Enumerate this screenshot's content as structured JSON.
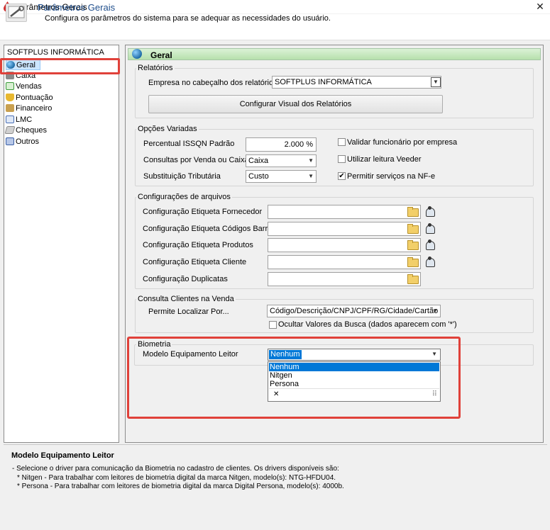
{
  "window": {
    "title": "Parâmetros Gerais",
    "close_glyph": "✕"
  },
  "header": {
    "title": "Parâmetros Gerais",
    "subtitle": "Configura os parâmetros do sistema para se adequar as necessidades do usuário."
  },
  "tree": {
    "root": "SOFTPLUS INFORMÁTICA",
    "items": [
      {
        "label": "Geral",
        "icon": "globe-icon",
        "color": "#2a7fc2"
      },
      {
        "label": "Caixa",
        "icon": "cash-register-icon",
        "color": "#7a7a7a"
      },
      {
        "label": "Vendas",
        "icon": "sales-icon",
        "color": "#3a9a3a"
      },
      {
        "label": "Pontuação",
        "icon": "trophy-icon",
        "color": "#d9a21a"
      },
      {
        "label": "Financeiro",
        "icon": "money-icon",
        "color": "#c48a2a"
      },
      {
        "label": "LMC",
        "icon": "document-icon",
        "color": "#4a6fb5"
      },
      {
        "label": "Cheques",
        "icon": "cheque-icon",
        "color": "#8a8a8a"
      },
      {
        "label": "Outros",
        "icon": "tools-icon",
        "color": "#3a5fa5"
      }
    ]
  },
  "panel": {
    "title": "Geral",
    "relatorios": {
      "legend": "Relatórios",
      "empresa_label": "Empresa no cabeçalho dos relatórios",
      "empresa_value": "SOFTPLUS INFORMÁTICA",
      "config_button": "Configurar Visual dos Relatórios"
    },
    "opcoes": {
      "legend": "Opções Variadas",
      "issqn_label": "Percentual ISSQN Padrão",
      "issqn_value": "2.000 %",
      "consultas_label": "Consultas por Venda ou Caixa",
      "consultas_value": "Caixa",
      "subst_label": "Substituição Tributária",
      "subst_value": "Custo",
      "validar_label": "Validar funcionário por empresa",
      "validar_checked": false,
      "veeder_label": "Utilizar leitura Veeder",
      "veeder_checked": false,
      "nfe_label": "Permitir serviços na NF-e",
      "nfe_checked": true
    },
    "arquivos": {
      "legend": "Configurações de arquivos",
      "rows": [
        {
          "label": "Configuração Etiqueta Fornecedor",
          "value": ""
        },
        {
          "label": "Configuração Etiqueta Códigos Barras",
          "value": ""
        },
        {
          "label": "Configuração Etiqueta Produtos",
          "value": ""
        },
        {
          "label": "Configuração Etiqueta Cliente",
          "value": ""
        },
        {
          "label": "Configuração Duplicatas",
          "value": ""
        }
      ]
    },
    "consulta": {
      "legend": "Consulta Clientes na Venda",
      "localizar_label": "Permite Localizar Por...",
      "localizar_value": "Código/Descrição/CNPJ/CPF/RG/Cidade/Cartão Fide",
      "ocultar_label": "Ocultar Valores da Busca (dados aparecem com '*')",
      "ocultar_checked": false
    },
    "biometria": {
      "legend": "Biometria",
      "modelo_label": "Modelo Equipamento Leitor",
      "selected": "Nenhum",
      "options": [
        "Nenhum",
        "Nitgen",
        "Persona"
      ],
      "clear_glyph": "✕",
      "grip_glyph": "⠿"
    }
  },
  "help": {
    "title": "Modelo Equipamento Leitor",
    "lines": [
      "- Selecione o driver para comunicação da Biometria no cadastro de clientes. Os drivers disponíveis são:",
      "* Nitgen - Para trabalhar com leitores de biometria digital da marca Nitgen, modelo(s): NTG-HFDU04.",
      "* Persona - Para trabalhar com leitores de biometria digital da marca Digital Persona, modelo(s): 4000b."
    ]
  },
  "colors": {
    "accent_red": "#e0413a",
    "selection_blue": "#0078d7",
    "header_title": "#1f4e8c"
  }
}
